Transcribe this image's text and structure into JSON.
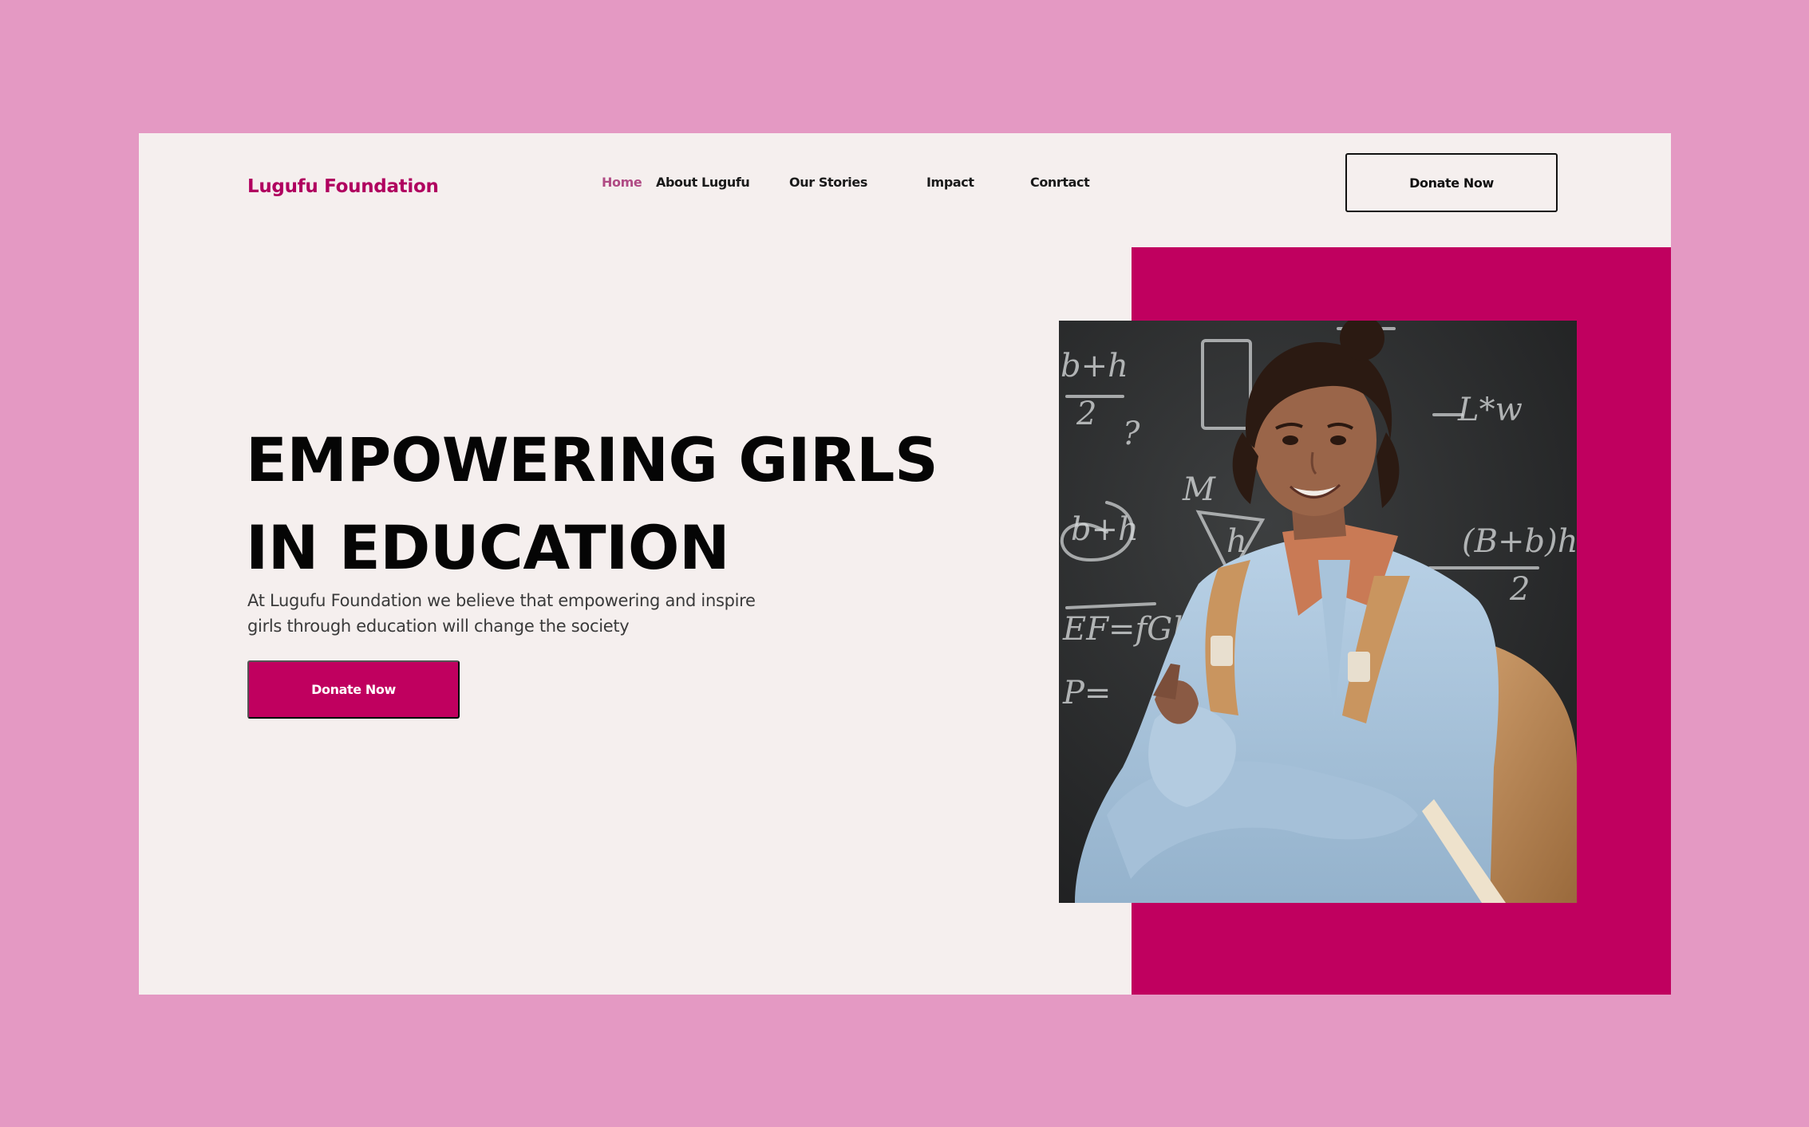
{
  "brand": {
    "name": "Lugufu Foundation",
    "accent_color": "#c0005f",
    "page_background": "#e499c3",
    "frame_background": "#f5efee"
  },
  "nav": {
    "items": [
      {
        "label": "Home",
        "active": true
      },
      {
        "label": "About Lugufu",
        "active": false
      },
      {
        "label": "Our Stories",
        "active": false
      },
      {
        "label": "Impact",
        "active": false
      },
      {
        "label": "Conrtact",
        "active": false
      }
    ],
    "donate_label": "Donate Now"
  },
  "hero": {
    "headline_line1": "EMPOWERING GIRLS",
    "headline_line2": "IN EDUCATION",
    "subtext_line1": "At Lugufu Foundation we believe that empowering and inspire",
    "subtext_line2": "girls through education will change the society",
    "donate_label": "Donate Now",
    "image_alt": "Smiling schoolgirl with backpack in front of a chalkboard",
    "chalk_scribbles": [
      "b+h",
      "2",
      "?",
      "L*w",
      "(B+b)h",
      "2",
      "b+h",
      "M",
      "EF=fGh",
      "P=",
      "h"
    ]
  }
}
